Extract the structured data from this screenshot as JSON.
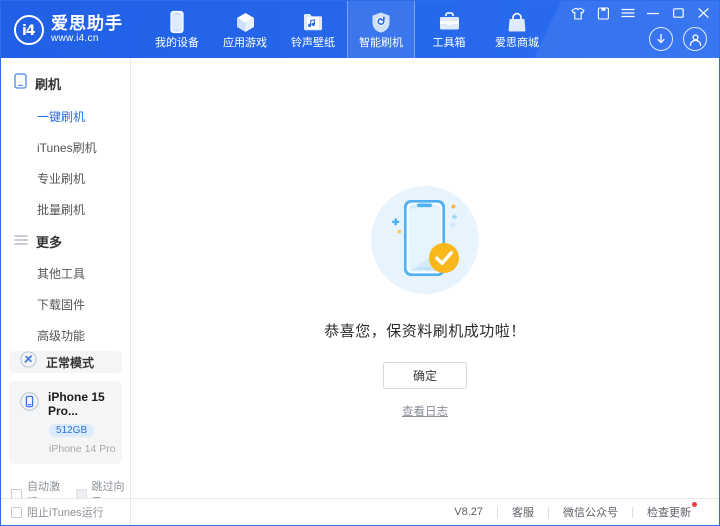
{
  "header": {
    "logo": {
      "mark": "i4",
      "title": "爱思助手",
      "subtitle": "www.i4.cn"
    },
    "nav": [
      {
        "label": "我的设备",
        "icon": "phone-icon",
        "active": false
      },
      {
        "label": "应用游戏",
        "icon": "cube-icon",
        "active": false
      },
      {
        "label": "铃声壁纸",
        "icon": "music-folder-icon",
        "active": false
      },
      {
        "label": "智能刷机",
        "icon": "shield-refresh-icon",
        "active": true
      },
      {
        "label": "工具箱",
        "icon": "toolbox-icon",
        "active": false
      },
      {
        "label": "爱思商城",
        "icon": "shopping-bag-icon",
        "active": false
      }
    ],
    "window_controls": [
      {
        "name": "theme-skin-icon",
        "glyph": "theme"
      },
      {
        "name": "message-icon",
        "glyph": "message"
      },
      {
        "name": "menu-icon",
        "glyph": "menu"
      },
      {
        "name": "minimize-icon",
        "glyph": "minimize"
      },
      {
        "name": "maximize-icon",
        "glyph": "maximize"
      },
      {
        "name": "close-icon",
        "glyph": "close"
      }
    ],
    "account_controls": [
      {
        "name": "download-icon"
      },
      {
        "name": "user-account-icon"
      }
    ]
  },
  "sidebar": {
    "groups": [
      {
        "label": "刷机",
        "icon": "phone-outline-icon",
        "items": [
          {
            "label": "一键刷机",
            "active": true
          },
          {
            "label": "iTunes刷机",
            "active": false
          },
          {
            "label": "专业刷机",
            "active": false
          },
          {
            "label": "批量刷机",
            "active": false
          }
        ]
      },
      {
        "label": "更多",
        "icon": "list-icon",
        "items": [
          {
            "label": "其他工具",
            "active": false
          },
          {
            "label": "下载固件",
            "active": false
          },
          {
            "label": "高级功能",
            "active": false
          }
        ]
      }
    ],
    "mode_card": {
      "label": "正常模式",
      "icon": "mode-icon"
    },
    "device_card": {
      "name": "iPhone 15 Pro...",
      "capacity": "512GB",
      "model": "iPhone 14 Pro",
      "icon": "device-icon"
    },
    "checkboxes": [
      {
        "label": "自动激活",
        "checked": false,
        "dim": false
      },
      {
        "label": "跳过向导",
        "checked": false,
        "dim": true
      }
    ]
  },
  "main": {
    "illustration": "phone-success-illustration",
    "success_text": "恭喜您，保资料刷机成功啦！",
    "confirm_button": "确定",
    "log_link": "查看日志"
  },
  "footer": {
    "itunes_checkbox": {
      "label": "阻止iTunes运行",
      "checked": false
    },
    "version": "V8.27",
    "items": [
      {
        "label": "客服",
        "badge": false
      },
      {
        "label": "微信公众号",
        "badge": false
      },
      {
        "label": "检查更新",
        "badge": true
      }
    ]
  },
  "colors": {
    "brand_blue": "#2364e8",
    "accent_blue": "#2a6fe8",
    "badge_bg": "#dbeafe",
    "badge_text": "#2f76d8",
    "success_yellow": "#f8b81c",
    "alert_red": "#ef3b3b"
  }
}
